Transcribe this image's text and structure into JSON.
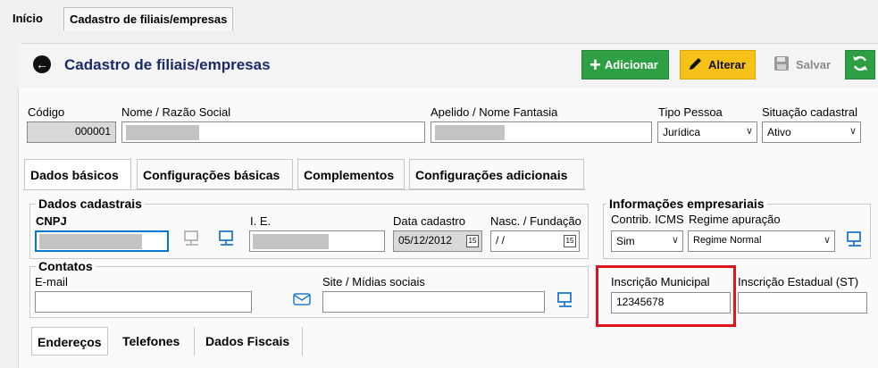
{
  "top_tabs": [
    {
      "label": "Início"
    },
    {
      "label": "Cadastro de filiais/empresas"
    }
  ],
  "header": {
    "title": "Cadastro de filiais/empresas",
    "buttons": {
      "add": "Adicionar",
      "alter": "Alterar",
      "save": "Salvar"
    },
    "colors": {
      "green": "#2ea043",
      "yellow": "#f6c21a",
      "title": "#1c2a6b"
    }
  },
  "main_fields": {
    "codigo": {
      "label": "Código",
      "value": "000001"
    },
    "nome": {
      "label": "Nome / Razão Social"
    },
    "apelido": {
      "label": "Apelido / Nome Fantasia"
    },
    "tipo_pessoa": {
      "label": "Tipo Pessoa",
      "value": "Jurídica"
    },
    "situacao": {
      "label": "Situação cadastral",
      "value": "Ativo"
    }
  },
  "tabs": [
    {
      "label": "Dados básicos"
    },
    {
      "label": "Configurações básicas"
    },
    {
      "label": "Complementos"
    },
    {
      "label": "Configurações adicionais"
    }
  ],
  "dados_cadastrais": {
    "title": "Dados cadastrais",
    "cnpj_label": "CNPJ",
    "ie_label": "I. E.",
    "data_cadastro_label": "Data cadastro",
    "data_cadastro_value": "05/12/2012",
    "nasc_label": "Nasc. / Fundação",
    "nasc_value": "/ /",
    "cal_glyph": "15"
  },
  "info_empresariais": {
    "title": "Informações empresariais",
    "contrib_label": "Contrib. ICMS",
    "contrib_value": "Sim",
    "regime_label": "Regime apuração",
    "regime_value": "Regime Normal",
    "insc_mun_label": "Inscrição Municipal",
    "insc_mun_value": "12345678",
    "insc_est_label": "Inscrição Estadual (ST)"
  },
  "contatos": {
    "title": "Contatos",
    "email_label": "E-mail",
    "site_label": "Site / Mídias sociais"
  },
  "sub_tabs": [
    {
      "label": "Endereços"
    },
    {
      "label": "Telefones"
    },
    {
      "label": "Dados Fiscais"
    }
  ],
  "icons": {
    "back": "arrow-left-icon",
    "add": "plus-icon",
    "alter": "pencil-icon",
    "save": "floppy-icon",
    "refresh": "refresh-icon",
    "network": "network-icon",
    "mail": "mail-icon",
    "dropdown": "chevron-down-icon"
  }
}
